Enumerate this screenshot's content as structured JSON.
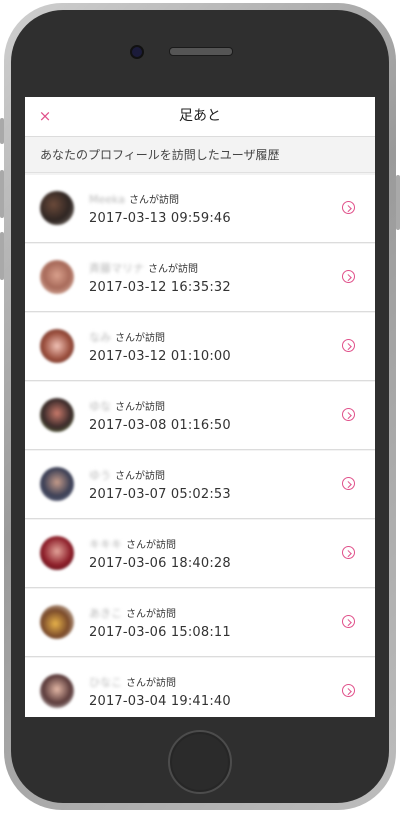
{
  "header": {
    "title": "足あと",
    "close_label": "×"
  },
  "section": {
    "heading": "あなたのプロフィールを訪問したユーザ履歴"
  },
  "visit_suffix": "さんが訪問",
  "visits": [
    {
      "name": "Meeka",
      "timestamp": "2017-03-13 09:59:46"
    },
    {
      "name": "斉藤マリナ",
      "timestamp": "2017-03-12 16:35:32"
    },
    {
      "name": "なみ",
      "timestamp": "2017-03-12 01:10:00"
    },
    {
      "name": "ゆな",
      "timestamp": "2017-03-08 01:16:50"
    },
    {
      "name": "ゆう",
      "timestamp": "2017-03-07 05:02:53"
    },
    {
      "name": "キキキ",
      "timestamp": "2017-03-06 18:40:28"
    },
    {
      "name": "あきこ",
      "timestamp": "2017-03-06 15:08:11"
    },
    {
      "name": "ひなこ",
      "timestamp": "2017-03-04 19:41:40"
    }
  ],
  "colors": {
    "accent": "#e0508a"
  }
}
